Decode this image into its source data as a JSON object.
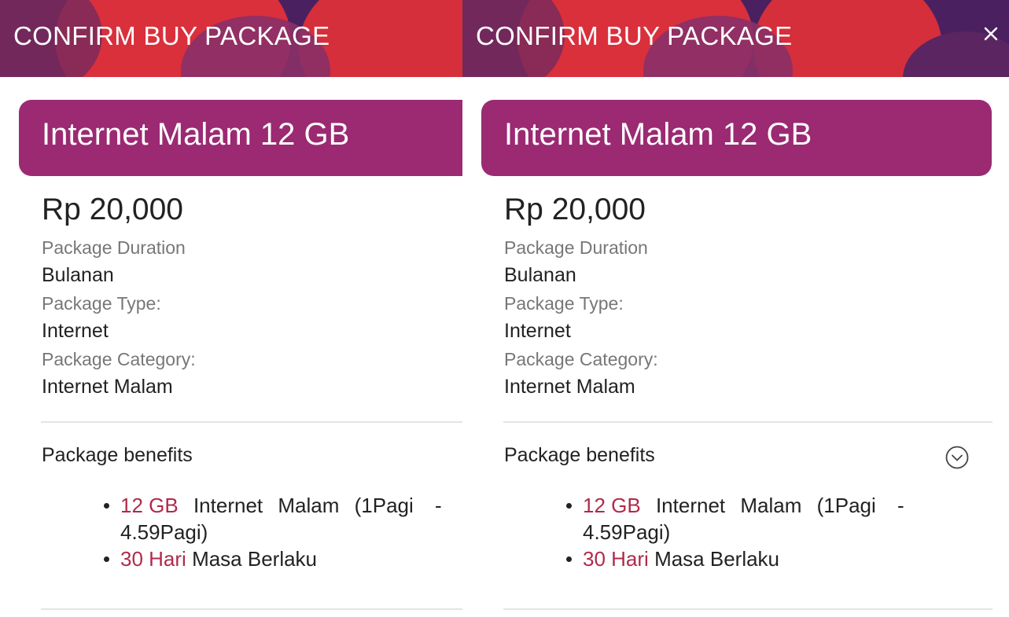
{
  "colors": {
    "header_bg": "#4a2060",
    "title_card_bg": "#9b2a72",
    "highlight": "#b02a4a",
    "blob_red": "#d9303c"
  },
  "icons": {
    "close": "close-icon",
    "expand": "chevron-down-circle-icon"
  },
  "header": {
    "title": "CONFIRM BUY PACKAGE"
  },
  "package": {
    "name": "Internet Malam 12 GB",
    "price": "Rp 20,000",
    "duration_label": "Package Duration",
    "duration_value": "Bulanan",
    "type_label": "Package Type:",
    "type_value": "Internet",
    "category_label": "Package Category:",
    "category_value": "Internet Malam"
  },
  "benefits": {
    "title": "Package benefits",
    "item1_highlight": "12 GB",
    "item1_text": "Internet",
    "item1_text2": "Malam",
    "item1_text3": "(1Pagi",
    "item1_dash": "-",
    "item1_line2": "4.59Pagi)",
    "item2_highlight": "30 Hari",
    "item2_text": "Masa Berlaku"
  }
}
